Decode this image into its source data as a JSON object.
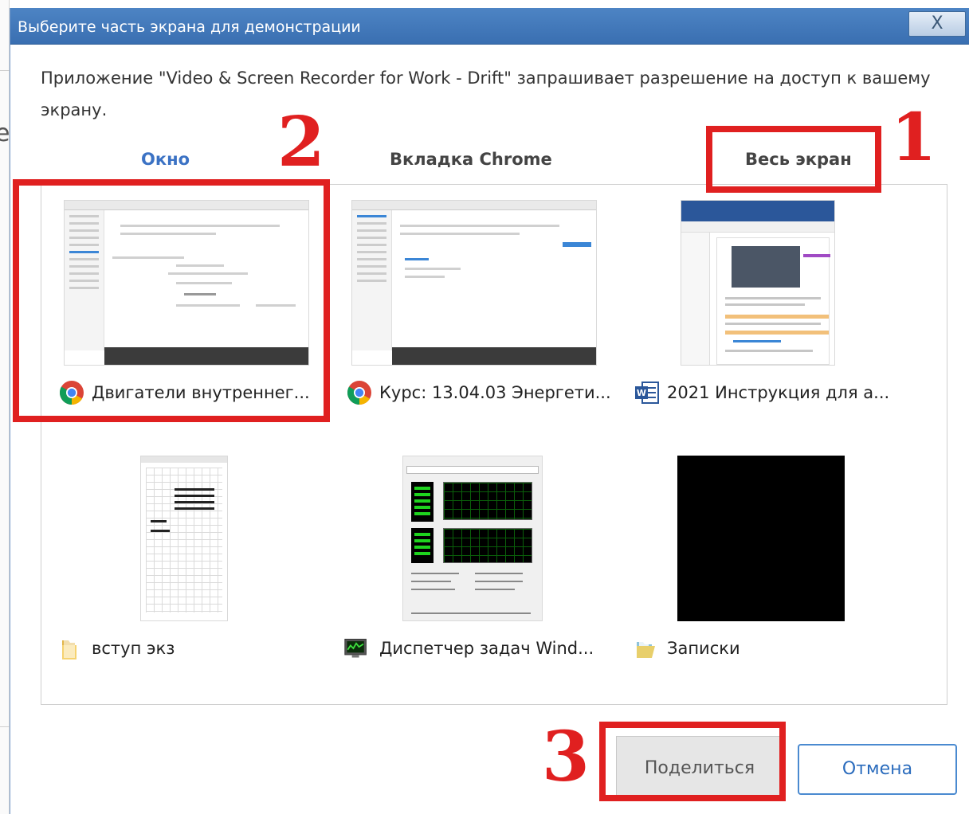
{
  "dialog": {
    "title": "Выберите часть экрана для демонстрации",
    "close_label": "X",
    "prompt": "Приложение \"Video & Screen Recorder for Work - Drift\" запрашивает разрешение на доступ к вашему экрану."
  },
  "tabs": [
    {
      "label": "Окно",
      "active": true
    },
    {
      "label": "Вкладка Chrome",
      "active": false
    },
    {
      "label": "Весь экран",
      "active": false
    }
  ],
  "windows": [
    {
      "label": "Двигатели внутреннег...",
      "icon": "chrome-icon",
      "selected": true
    },
    {
      "label": "Курс: 13.04.03 Энергети...",
      "icon": "chrome-icon",
      "selected": false
    },
    {
      "label": "2021 Инструкция для а...",
      "icon": "word-icon",
      "selected": false
    },
    {
      "label": "вступ экз",
      "icon": "folder-icon",
      "selected": false
    },
    {
      "label": "Диспетчер задач Wind...",
      "icon": "task-manager-icon",
      "selected": false
    },
    {
      "label": "Записки",
      "icon": "folder-icon",
      "selected": false
    }
  ],
  "annotations": {
    "step1": "1",
    "step2": "2",
    "step3": "3"
  },
  "buttons": {
    "share": "Поделиться",
    "cancel": "Отмена"
  },
  "colors": {
    "titlebar": "#3a6fb1",
    "active_tab": "#3b72c4",
    "annotation_red": "#e02020",
    "cancel_border": "#4a8ad0"
  }
}
